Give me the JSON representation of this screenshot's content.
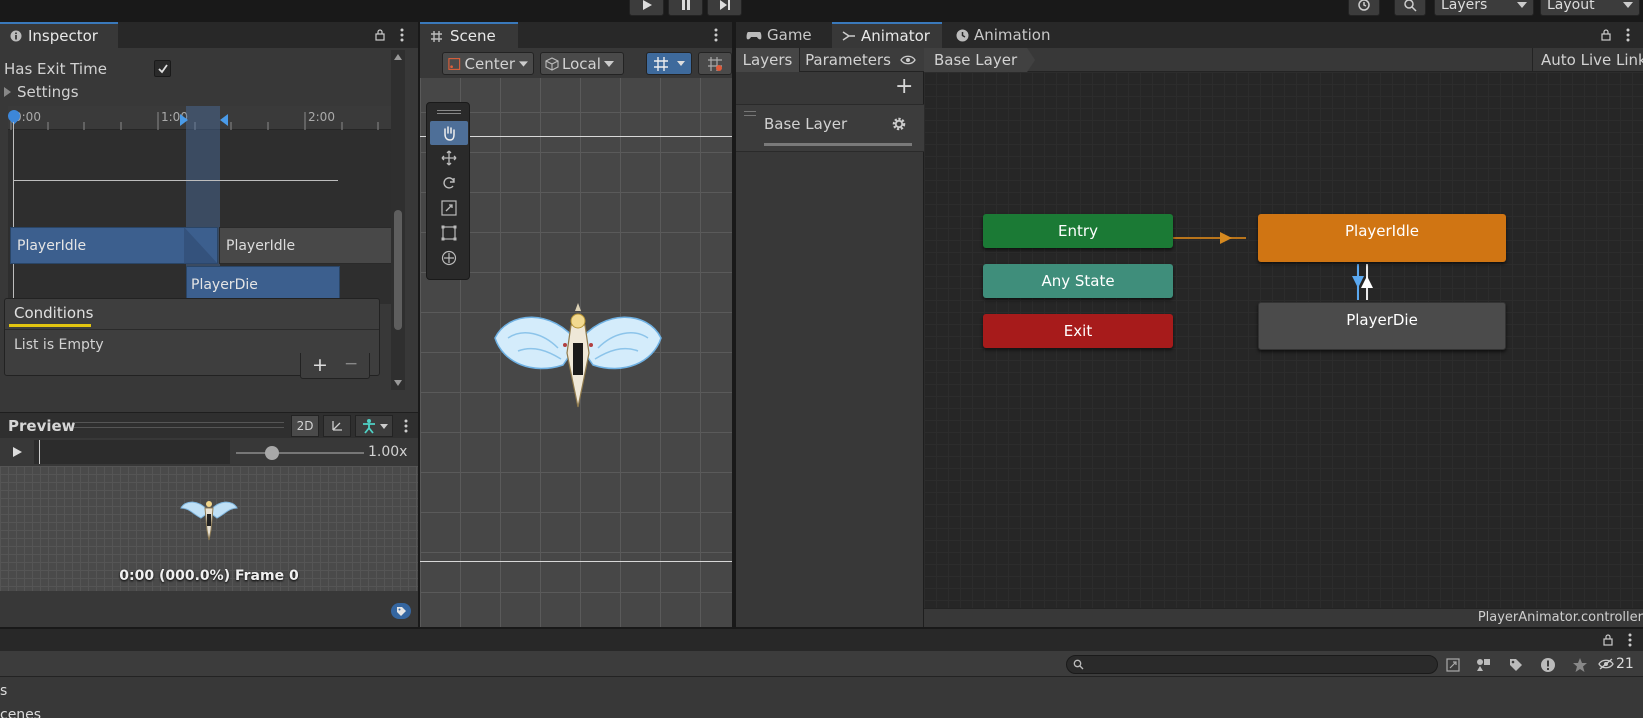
{
  "toolbar": {
    "layers_dropdown": "Layers",
    "layout_dropdown": "Layout"
  },
  "inspector": {
    "tab_label": "Inspector",
    "has_exit_time_label": "Has Exit Time",
    "has_exit_time_checked": true,
    "settings_label": "Settings",
    "timeline": {
      "ticks": [
        "0:00",
        "1:00",
        "2:00"
      ],
      "clip_rows": [
        {
          "from": "PlayerIdle",
          "to": "PlayerIdle"
        },
        {
          "clip": "PlayerDie"
        }
      ]
    },
    "conditions_label": "Conditions",
    "conditions_empty": "List is Empty",
    "add_symbol": "+",
    "remove_symbol": "−"
  },
  "preview": {
    "title": "Preview",
    "mode_2d": "2D",
    "speed": "1.00x",
    "speed_fraction": 0.28,
    "status": "0:00 (000.0%) Frame 0"
  },
  "scene": {
    "tab_label": "Scene",
    "pivot_label": "Center",
    "space_label": "Local"
  },
  "animator": {
    "game_tab": "Game",
    "animator_tab": "Animator",
    "animation_tab": "Animation",
    "layers_subtab": "Layers",
    "parameters_subtab": "Parameters",
    "breadcrumb": "Base Layer",
    "auto_live_link": "Auto Live Link",
    "layer_item": "Base Layer",
    "add_symbol": "+",
    "states": {
      "entry": "Entry",
      "any_state": "Any State",
      "exit": "Exit",
      "idle": "PlayerIdle",
      "die": "PlayerDie"
    },
    "colors": {
      "entry": "#1b7a35",
      "any_state": "#3f8e7b",
      "exit": "#a71b1b",
      "default_state": "#d07513",
      "state": "#4b4b4b"
    },
    "footer_file": "PlayerAnimator.controller"
  },
  "bottom": {
    "search_placeholder": "",
    "hidden_count": "21",
    "row1": "s",
    "row2": "cenes"
  }
}
